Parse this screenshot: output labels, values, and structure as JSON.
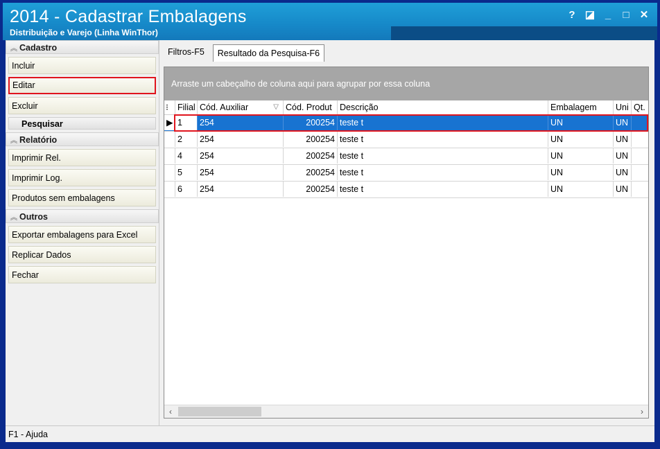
{
  "window": {
    "title": "2014 - Cadastrar Embalagens",
    "subtitle": "Distribuição e Varejo (Linha WinThor)",
    "controls": {
      "help": "?",
      "restore": "◪",
      "minimize": "_",
      "maximize": "□",
      "close": "✕"
    }
  },
  "sidebar": {
    "cadastro": {
      "title": "Cadastro",
      "incluir": "Incluir",
      "editar": "Editar",
      "excluir": "Excluir",
      "pesquisar": "Pesquisar"
    },
    "relatorio": {
      "title": "Relatório",
      "imprimir_rel": "Imprimir Rel.",
      "imprimir_log": "Imprimir Log.",
      "produtos_sem": "Produtos sem embalagens"
    },
    "outros": {
      "title": "Outros",
      "exportar": "Exportar embalagens para Excel",
      "replicar": "Replicar Dados",
      "fechar": "Fechar"
    }
  },
  "tabs": {
    "filtros": "Filtros-F5",
    "resultado": "Resultado da Pesquisa-F6"
  },
  "grid": {
    "group_hint": "Arraste um cabeçalho de coluna aqui para agrupar por essa coluna",
    "columns": {
      "filial": "Filial",
      "cod_auxiliar": "Cód. Auxiliar",
      "cod_produto": "Cód. Produt",
      "descricao": "Descrição",
      "embalagem": "Embalagem",
      "unidade": "Uni",
      "qt": "Qt."
    },
    "rows": [
      {
        "filial": "1",
        "cod_auxiliar": "254",
        "cod_produto": "200254",
        "descricao": "teste t",
        "embalagem": "UN",
        "unidade": "UN"
      },
      {
        "filial": "2",
        "cod_auxiliar": "254",
        "cod_produto": "200254",
        "descricao": "teste t",
        "embalagem": "UN",
        "unidade": "UN"
      },
      {
        "filial": "4",
        "cod_auxiliar": "254",
        "cod_produto": "200254",
        "descricao": "teste t",
        "embalagem": "UN",
        "unidade": "UN"
      },
      {
        "filial": "5",
        "cod_auxiliar": "254",
        "cod_produto": "200254",
        "descricao": "teste t",
        "embalagem": "UN",
        "unidade": "UN"
      },
      {
        "filial": "6",
        "cod_auxiliar": "254",
        "cod_produto": "200254",
        "descricao": "teste t",
        "embalagem": "UN",
        "unidade": "UN"
      }
    ]
  },
  "status": {
    "help": "F1 - Ajuda"
  },
  "colors": {
    "titlebar": "#1688c8",
    "selection": "#1873d1",
    "highlight": "#e0141d"
  }
}
